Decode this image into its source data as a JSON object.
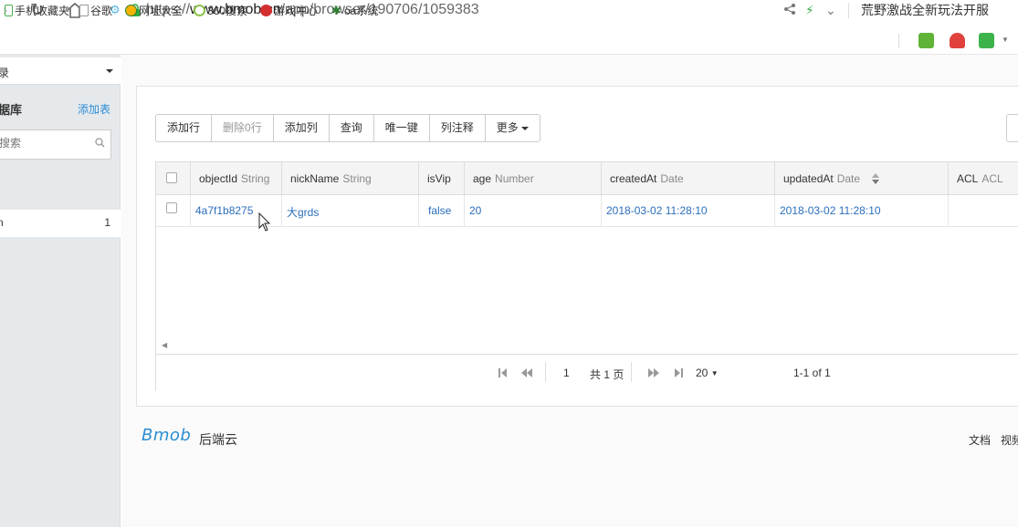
{
  "browser": {
    "url_scheme": "https://",
    "url_host": "www.bmob.cn",
    "url_path": "/app/browser/190706/1059383",
    "news_text": "荒野激战全新玩法开服"
  },
  "bookmarks": [
    {
      "label": "手机收藏夹",
      "icon": "phone-icon",
      "color": "#4caf50"
    },
    {
      "label": "谷歌",
      "icon": "page-icon",
      "color": "#999999"
    },
    {
      "label": "网址大全",
      "icon": "plus-circle-icon",
      "color": "#f4b400"
    },
    {
      "label": "360搜索",
      "icon": "ring-icon",
      "color": "#8bc34a"
    },
    {
      "label": "游戏中心",
      "icon": "game-icon",
      "color": "#d32f2f"
    },
    {
      "label": "oa系统",
      "icon": "gear-icon",
      "color": "#2e7d32"
    }
  ],
  "sidebar": {
    "app_name": "录",
    "db_title": "据库",
    "add_table": "添加表",
    "search_placeholder": "搜索",
    "tables": [
      {
        "name": "n",
        "count": "1"
      }
    ]
  },
  "toolbar": {
    "buttons": [
      "添加行",
      "删除0行",
      "添加列",
      "查询",
      "唯一键",
      "列注释",
      "更多"
    ]
  },
  "grid": {
    "columns": [
      {
        "name": "objectId",
        "type": "String"
      },
      {
        "name": "nickName",
        "type": "String"
      },
      {
        "name": "isVip",
        "type": ""
      },
      {
        "name": "age",
        "type": "Number"
      },
      {
        "name": "createdAt",
        "type": "Date"
      },
      {
        "name": "updatedAt",
        "type": "Date"
      },
      {
        "name": "ACL",
        "type": "ACL"
      }
    ],
    "rows": [
      {
        "objectId": "4a7f1b8275",
        "nickName": "大grds",
        "isVip": "false",
        "age": "20",
        "createdAt": "2018-03-02 11:28:10",
        "updatedAt": "2018-03-02 11:28:10",
        "ACL": ""
      }
    ]
  },
  "pager": {
    "page": "1",
    "total_pages": "共 1 页",
    "page_size": "20",
    "range": "1-1 of 1"
  },
  "footer": {
    "logo": "Bmob",
    "sub": "后端云",
    "links": [
      "文档",
      "视频"
    ]
  },
  "colors": {
    "accent": "#2a8dd4",
    "link": "#2a6ebb"
  }
}
